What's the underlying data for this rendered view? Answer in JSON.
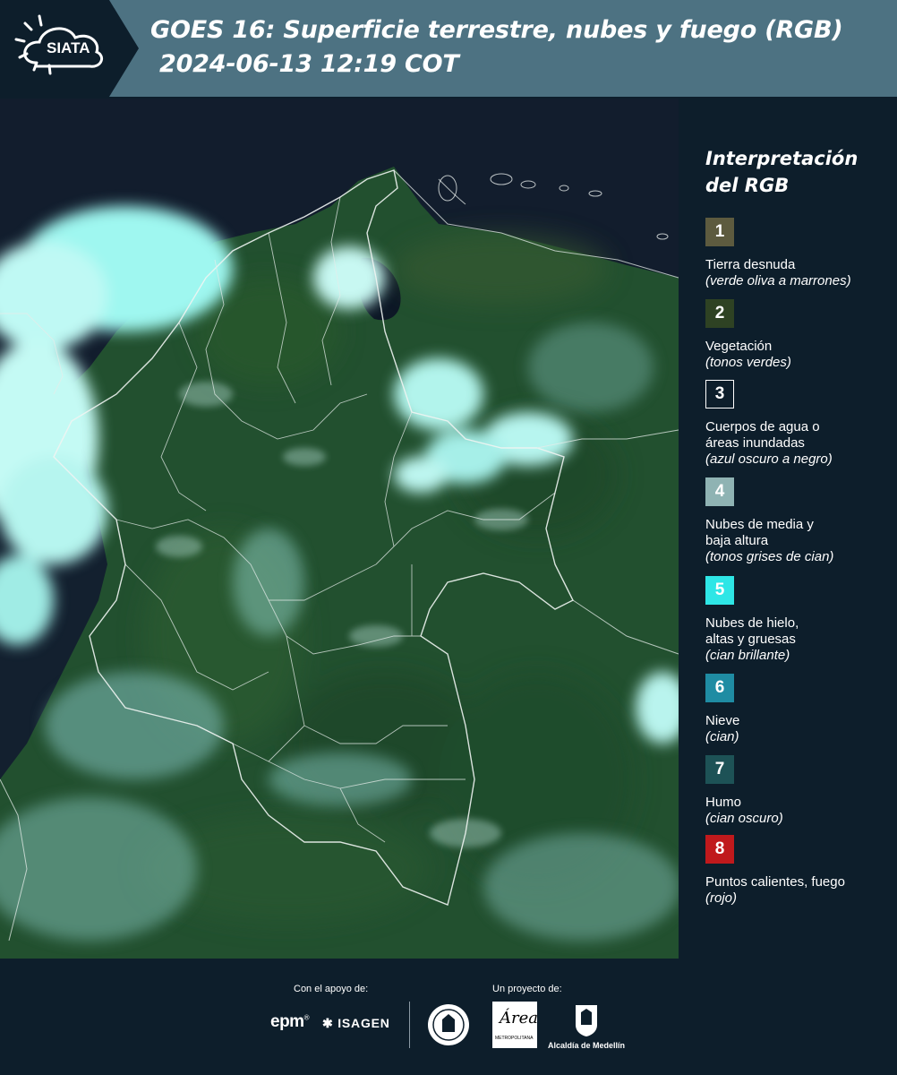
{
  "header": {
    "logo_text": "SIATA",
    "title_line1": "GOES 16: Superficie terrestre, nubes y fuego (RGB)",
    "title_line2": "2024-06-13 12:19 COT"
  },
  "map": {
    "icon": "satellite-rgb-map"
  },
  "legend": {
    "title": "Interpretación del RGB",
    "items": [
      {
        "number": "1",
        "label": "Tierra desnuda",
        "note": "(verde oliva a marrones)",
        "color": "#5d5b3f"
      },
      {
        "number": "2",
        "label": "Vegetación",
        "note": "(tonos verdes)",
        "color": "#2e4223"
      },
      {
        "number": "3",
        "label": "Cuerpos de agua o\náreas inundadas",
        "note": "(azul oscuro a negro)",
        "color": "#0d1e2b"
      },
      {
        "number": "4",
        "label": "Nubes de media y\nbaja altura",
        "note": "(tonos grises de cian)",
        "color": "#8fb3b3"
      },
      {
        "number": "5",
        "label": "Nubes de hielo,\naltas y gruesas",
        "note": "(cian brillante)",
        "color": "#2ee6e6"
      },
      {
        "number": "6",
        "label": "Nieve",
        "note": "(cian)",
        "color": "#1f8ca3"
      },
      {
        "number": "7",
        "label": "Humo",
        "note": "(cian oscuro)",
        "color": "#1d5256"
      },
      {
        "number": "8",
        "label": "Puntos calientes, fuego",
        "note": "(rojo)",
        "color": "#c0191c"
      }
    ]
  },
  "footer": {
    "support_label": "Con el apoyo de:",
    "project_label": "Un proyecto de:",
    "epm": "epm",
    "isagen": "ISAGEN",
    "metro_logo": "Área",
    "metro_name": "METROPOLITANA",
    "alcaldia": "Alcaldía de Medellín"
  }
}
